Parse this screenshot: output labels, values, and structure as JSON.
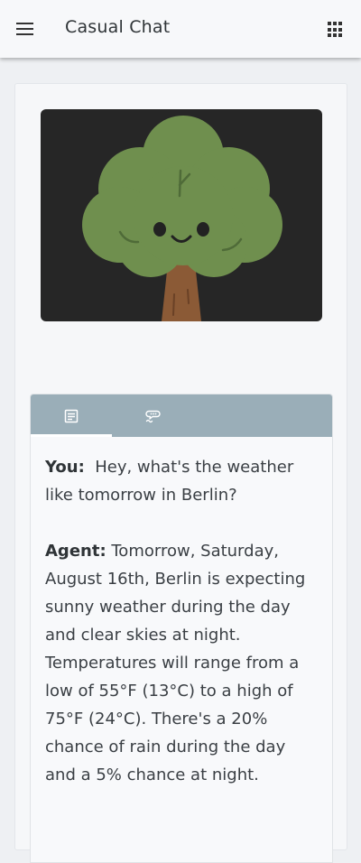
{
  "appbar": {
    "title": "Casual Chat",
    "menu_icon": "hamburger-menu-icon",
    "apps_icon": "apps-grid-icon"
  },
  "hero": {
    "illustration": "smiling-tree",
    "colors": {
      "background": "#262626",
      "foliage": "#6f8f4e",
      "trunk": "#8b5a36"
    }
  },
  "tabs": [
    {
      "icon": "document-text-icon",
      "selected": true
    },
    {
      "icon": "voice-chat-icon",
      "selected": false
    }
  ],
  "transcript": [
    {
      "speaker": "You:",
      "text": "Hey, what's the weather like tomorrow in Berlin?"
    },
    {
      "speaker": "Agent:",
      "text": "Tomorrow, Saturday, August 16th, Berlin is expecting sunny weather during the day and clear skies at night. Temperatures will range from a low of 55°F (13°C) to a high of 75°F (24°C). There's a 20% chance of rain during the day and a 5% chance at night."
    }
  ],
  "colors": {
    "tabbar": "#9aaeb8",
    "indicator": "#ffffff",
    "appbar": "#f7f8fa"
  }
}
